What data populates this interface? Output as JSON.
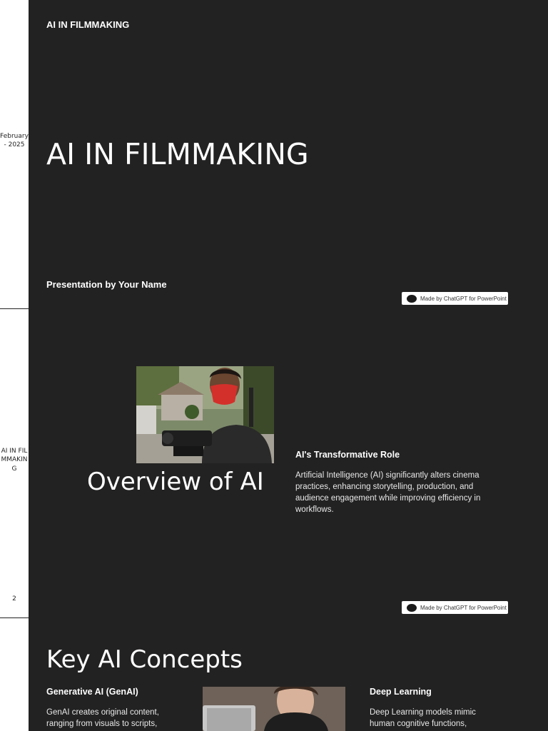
{
  "sidebar": {
    "date": "February - 2025",
    "deck_title": "AI IN FILMMAKING",
    "page_number": "2"
  },
  "slide1": {
    "header": "AI IN FILMMAKING",
    "title": "AI IN FILMMAKING",
    "presenter": "Presentation by Your Name",
    "badge": "Made by ChatGPT for PowerPoint"
  },
  "slide2": {
    "title": "Overview of AI",
    "subheading": "AI's Transformative Role",
    "body": "Artificial Intelligence (AI) significantly alters cinema practices, enhancing storytelling, production, and audience engagement while improving efficiency in workflows.",
    "badge": "Made by ChatGPT for PowerPoint"
  },
  "slide3": {
    "title": "Key AI Concepts",
    "col1_heading": "Generative AI (GenAI)",
    "col1_body": "GenAI creates original content, ranging from visuals to scripts,",
    "col2_heading": "Deep Learning",
    "col2_body": "Deep Learning models mimic human cognitive functions,"
  }
}
